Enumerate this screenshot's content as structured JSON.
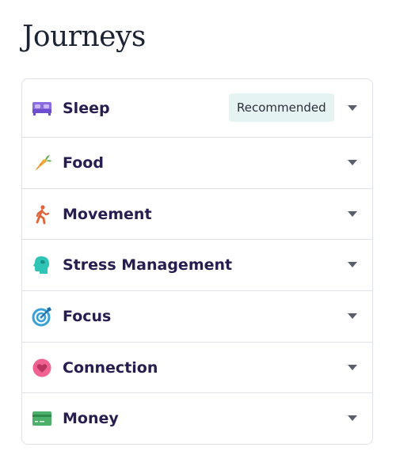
{
  "page": {
    "title": "Journeys"
  },
  "journeys": [
    {
      "label": "Sleep",
      "icon": "bed-icon",
      "badge": "Recommended"
    },
    {
      "label": "Food",
      "icon": "carrot-icon"
    },
    {
      "label": "Movement",
      "icon": "walking-person-icon"
    },
    {
      "label": "Stress Management",
      "icon": "head-brain-icon"
    },
    {
      "label": "Focus",
      "icon": "target-icon"
    },
    {
      "label": "Connection",
      "icon": "heart-icon"
    },
    {
      "label": "Money",
      "icon": "credit-card-icon"
    }
  ],
  "colors": {
    "title": "#1c2333",
    "label": "#271d4f",
    "border": "#dfe2e8",
    "badge_bg": "#e6f3f3",
    "chevron": "#5a5f6e",
    "sleep_icon": "#8b6be0",
    "food_icon": "#f2a93b",
    "movement_icon": "#e0643a",
    "stress_icon": "#2ec4b6",
    "focus_icon": "#3aa0d8",
    "connection_icon": "#f06292",
    "money_icon": "#4caf6a"
  }
}
